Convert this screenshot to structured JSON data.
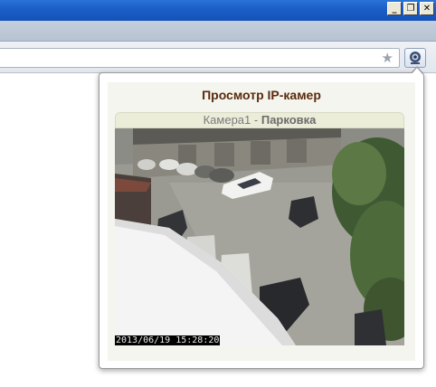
{
  "window": {
    "buttons": [
      "_",
      "❐",
      "✕"
    ]
  },
  "toolbar": {
    "bookmark_icon": "star-icon",
    "extension_icon": "webcam-icon"
  },
  "popup": {
    "title": "Просмотр IP-камер",
    "camera": {
      "name": "Камера1",
      "separator": " - ",
      "location": "Парковка",
      "timestamp": "2013/06/19 15:28:20"
    }
  }
}
